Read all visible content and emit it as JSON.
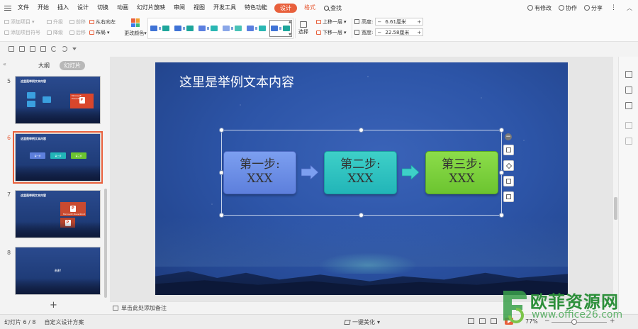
{
  "menu": {
    "items": [
      "文件",
      "开始",
      "插入",
      "设计",
      "切换",
      "动画",
      "幻灯片放映",
      "审阅",
      "视图",
      "开发工具",
      "特色功能"
    ],
    "design_tab": "设计",
    "format_tab": "格式",
    "search": "查找"
  },
  "header_right": {
    "changes": "有修改",
    "collab": "协作",
    "share": "分享"
  },
  "ribbon": {
    "add_item": "添加项目",
    "add_bullet": "添加项目符号",
    "promote": "升级",
    "demote": "降级",
    "move_forward": "前移",
    "move_back": "后移",
    "rtl": "从右向左",
    "layout": "布局",
    "change_color": "更改颜色",
    "select": "选择",
    "move_up": "上移一层",
    "move_down": "下移一层",
    "height_label": "高度:",
    "height_value": "6.61厘米",
    "width_label": "宽度:",
    "width_value": "22.58厘米",
    "minus": "−",
    "plus": "+"
  },
  "style_gallery": {
    "colors": [
      "#3f73d6",
      "#1ea69b",
      "#3f73d6",
      "#1ea69b",
      "#5b7fe0",
      "#2ab7b3",
      "#8aa7e8",
      "#49c2b6",
      "#5b7fe0",
      "#2ab7b3",
      "#3f73d6",
      "#1ea69b"
    ],
    "selected_index": 5
  },
  "pane": {
    "tab_outline": "大纲",
    "tab_slides": "幻灯片",
    "slides": [
      {
        "num": "5",
        "title": "这里是举例文本内容"
      },
      {
        "num": "6",
        "title": "这里是举例文本内容",
        "steps": [
          "第一步",
          "第二步",
          "第三步"
        ]
      },
      {
        "num": "7",
        "title": "这里是举例文本内容"
      },
      {
        "num": "8",
        "center_text": "谢谢!"
      }
    ],
    "ppt_label": "Microsoft PowerPoint",
    "add_slide": "+"
  },
  "slide": {
    "title": "这里是举例文本内容",
    "steps": [
      {
        "label": "第一步:",
        "value": "XXX"
      },
      {
        "label": "第二步:",
        "value": "XXX"
      },
      {
        "label": "第三步:",
        "value": "XXX"
      }
    ],
    "arrow_colors": [
      "#7c9ff0",
      "#3ed0c8"
    ]
  },
  "notes": {
    "placeholder": "单击此处添加备注"
  },
  "status": {
    "slide_pos": "幻灯片 6 / 8",
    "design_scheme": "自定义设计方案",
    "beautify": "一键美化",
    "zoom": "77%",
    "zoom_minus": "−",
    "zoom_plus": "+",
    "zoom_level": 0.41
  },
  "watermark": {
    "cn": "欧菲资源网",
    "url": "www.office26.com"
  }
}
